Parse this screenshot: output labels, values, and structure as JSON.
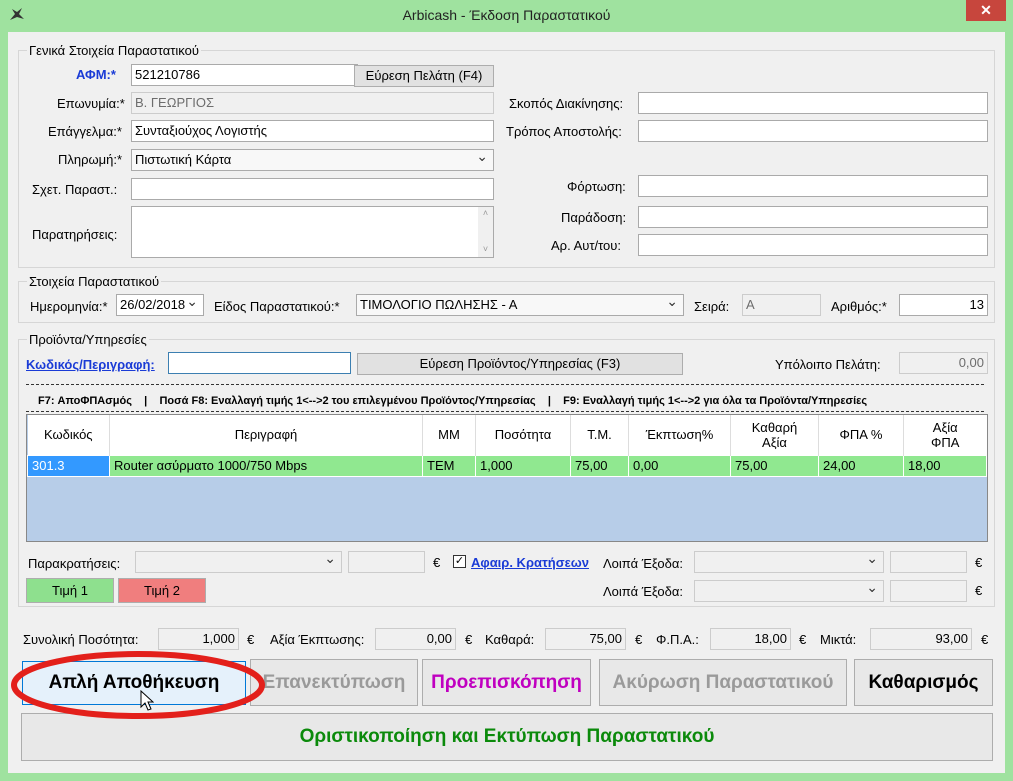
{
  "window": {
    "title": "Arbicash - Έκδοση Παραστατικού",
    "close_label": "✕"
  },
  "general": {
    "title": "Γενικά Στοιχεία Παραστατικού",
    "afm_label": "ΑΦΜ:*",
    "afm_value": "521210786",
    "find_customer_label": "Εύρεση Πελάτη (F4)",
    "name_label": "Επωνυμία:*",
    "name_value": "Β. ΓΕΩΡΓΙΟΣ",
    "profession_label": "Επάγγελμα:*",
    "profession_value": "Συνταξιούχος Λογιστής",
    "payment_label": "Πληρωμή:*",
    "payment_value": "Πιστωτική Κάρτα",
    "related_doc_label": "Σχετ. Παραστ.:",
    "related_doc_value": "",
    "notes_label": "Παρατηρήσεις:",
    "notes_value": "",
    "purpose_label": "Σκοπός Διακίνησης:",
    "purpose_value": "",
    "shipping_label": "Τρόπος Αποστολής:",
    "shipping_value": "",
    "loading_label": "Φόρτωση:",
    "loading_value": "",
    "delivery_label": "Παράδοση:",
    "delivery_value": "",
    "vehicle_label": "Αρ. Αυτ/του:",
    "vehicle_value": ""
  },
  "document": {
    "title": "Στοιχεία Παραστατικού",
    "date_label": "Ημερομηνία:*",
    "date_value": "26/02/2018",
    "type_label": "Είδος Παραστατικού:*",
    "type_value": "ΤΙΜΟΛΟΓΙΟ ΠΩΛΗΣΗΣ - Α",
    "series_label": "Σειρά:",
    "series_value": "A",
    "number_label": "Αριθμός:*",
    "number_value": "13"
  },
  "products": {
    "title": "Προϊόντα/Υπηρεσίες",
    "code_link": "Κωδικός/Περιγραφή:",
    "code_value": "",
    "find_product_label": "Εύρεση Προϊόντος/Υπηρεσίας (F3)",
    "balance_label": "Υπόλοιπο Πελάτη:",
    "balance_value": "0,00",
    "hints": "F7: ΑποΦΠΑσμός    |    Ποσά F8: Εναλλαγή τιμής 1<-->2 του επιλεγμένου Προϊόντος/Υπηρεσίας    |    F9: Εναλλαγή τιμής 1<-->2 για όλα τα Προϊόντα/Υπηρεσίες",
    "columns": [
      "Κωδικός",
      "Περιγραφή",
      "ΜΜ",
      "Ποσότητα",
      "Τ.Μ.",
      "Έκπτωση%",
      "Καθαρή Αξία",
      "ΦΠΑ %",
      "Αξία ΦΠΑ"
    ],
    "rows": [
      [
        "301.3",
        "Router ασύρματο 1000/750 Mbps",
        "TEM",
        "1,000",
        "75,00",
        "0,00",
        "75,00",
        "24,00",
        "18,00"
      ]
    ],
    "withholding_label": "Παρακρατήσεις:",
    "withholding_value": "",
    "withholding_amount": "",
    "euro": "€",
    "deduct_link": "Αφαιρ. Κρατήσεων",
    "other_exp_label": "Λοιπά Έξοδα:",
    "other_exp1_amount": "",
    "other_exp2_amount": "",
    "price1_label": "Τιμή 1",
    "price2_label": "Τιμή 2"
  },
  "totals": {
    "qty_label": "Συνολική Ποσότητα:",
    "qty_value": "1,000",
    "discount_label": "Αξία Έκπτωσης:",
    "discount_value": "0,00",
    "net_label": "Καθαρά:",
    "net_value": "75,00",
    "vat_label": "Φ.Π.Α.:",
    "vat_value": "18,00",
    "gross_label": "Μικτά:",
    "gross_value": "93,00"
  },
  "actions": {
    "save_label": "Απλή Αποθήκευση",
    "reprint_label": "Επανεκτύπωση",
    "preview_label": "Προεπισκόπηση",
    "cancel_label": "Ακύρωση Παραστατικού",
    "clear_label": "Καθαρισμός",
    "finalize_label": "Οριστικοποίηση και Εκτύπωση Παραστατικού"
  },
  "colors": {
    "titlebar": "#9fe29f",
    "row_selected": "#90e890",
    "grid_empty": "#b7cde8",
    "highlight_ring": "#e3201b",
    "preview_text": "#c000c0",
    "finalize_text": "#0b8a0b"
  }
}
